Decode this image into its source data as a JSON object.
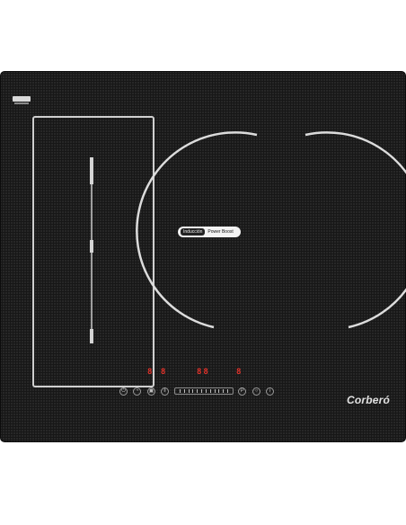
{
  "product": {
    "brand_logo": "Corberó",
    "top_badge": "ORB·YS"
  },
  "zones": {
    "round_zone_badge": {
      "left_text": "Inducción",
      "right_text": "Power Boost"
    }
  },
  "displays": {
    "left_pair": "8 8",
    "middle_pair": "88",
    "right_single": "8"
  },
  "controls": {
    "icons": [
      "power-icon",
      "timer-icon",
      "lock-icon",
      "pause-icon",
      "plus-icon",
      "minus-icon",
      "info-icon"
    ],
    "slider_ticks": 12
  },
  "colors": {
    "glass": "#171717",
    "outline": "#cfcfcf",
    "display": "#e4332b"
  }
}
